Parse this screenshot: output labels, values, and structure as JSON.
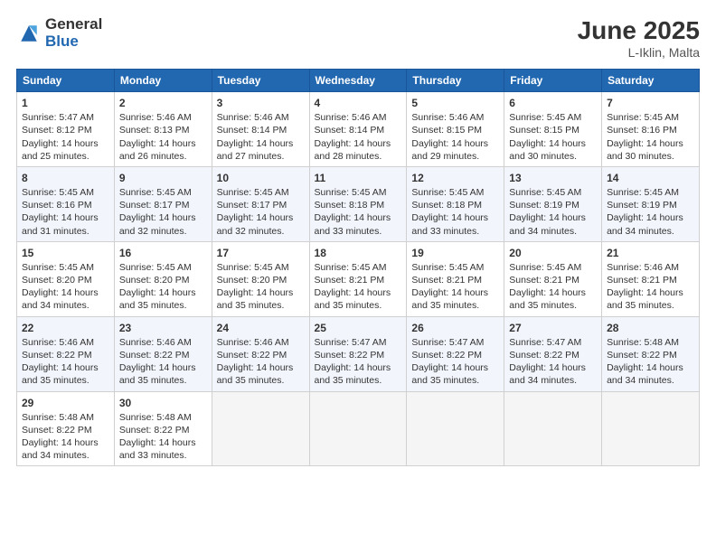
{
  "logo": {
    "general": "General",
    "blue": "Blue"
  },
  "title": "June 2025",
  "subtitle": "L-Iklin, Malta",
  "headers": [
    "Sunday",
    "Monday",
    "Tuesday",
    "Wednesday",
    "Thursday",
    "Friday",
    "Saturday"
  ],
  "weeks": [
    [
      {
        "day": "1",
        "lines": [
          "Sunrise: 5:47 AM",
          "Sunset: 8:12 PM",
          "Daylight: 14 hours",
          "and 25 minutes."
        ]
      },
      {
        "day": "2",
        "lines": [
          "Sunrise: 5:46 AM",
          "Sunset: 8:13 PM",
          "Daylight: 14 hours",
          "and 26 minutes."
        ]
      },
      {
        "day": "3",
        "lines": [
          "Sunrise: 5:46 AM",
          "Sunset: 8:14 PM",
          "Daylight: 14 hours",
          "and 27 minutes."
        ]
      },
      {
        "day": "4",
        "lines": [
          "Sunrise: 5:46 AM",
          "Sunset: 8:14 PM",
          "Daylight: 14 hours",
          "and 28 minutes."
        ]
      },
      {
        "day": "5",
        "lines": [
          "Sunrise: 5:46 AM",
          "Sunset: 8:15 PM",
          "Daylight: 14 hours",
          "and 29 minutes."
        ]
      },
      {
        "day": "6",
        "lines": [
          "Sunrise: 5:45 AM",
          "Sunset: 8:15 PM",
          "Daylight: 14 hours",
          "and 30 minutes."
        ]
      },
      {
        "day": "7",
        "lines": [
          "Sunrise: 5:45 AM",
          "Sunset: 8:16 PM",
          "Daylight: 14 hours",
          "and 30 minutes."
        ]
      }
    ],
    [
      {
        "day": "8",
        "lines": [
          "Sunrise: 5:45 AM",
          "Sunset: 8:16 PM",
          "Daylight: 14 hours",
          "and 31 minutes."
        ]
      },
      {
        "day": "9",
        "lines": [
          "Sunrise: 5:45 AM",
          "Sunset: 8:17 PM",
          "Daylight: 14 hours",
          "and 32 minutes."
        ]
      },
      {
        "day": "10",
        "lines": [
          "Sunrise: 5:45 AM",
          "Sunset: 8:17 PM",
          "Daylight: 14 hours",
          "and 32 minutes."
        ]
      },
      {
        "day": "11",
        "lines": [
          "Sunrise: 5:45 AM",
          "Sunset: 8:18 PM",
          "Daylight: 14 hours",
          "and 33 minutes."
        ]
      },
      {
        "day": "12",
        "lines": [
          "Sunrise: 5:45 AM",
          "Sunset: 8:18 PM",
          "Daylight: 14 hours",
          "and 33 minutes."
        ]
      },
      {
        "day": "13",
        "lines": [
          "Sunrise: 5:45 AM",
          "Sunset: 8:19 PM",
          "Daylight: 14 hours",
          "and 34 minutes."
        ]
      },
      {
        "day": "14",
        "lines": [
          "Sunrise: 5:45 AM",
          "Sunset: 8:19 PM",
          "Daylight: 14 hours",
          "and 34 minutes."
        ]
      }
    ],
    [
      {
        "day": "15",
        "lines": [
          "Sunrise: 5:45 AM",
          "Sunset: 8:20 PM",
          "Daylight: 14 hours",
          "and 34 minutes."
        ]
      },
      {
        "day": "16",
        "lines": [
          "Sunrise: 5:45 AM",
          "Sunset: 8:20 PM",
          "Daylight: 14 hours",
          "and 35 minutes."
        ]
      },
      {
        "day": "17",
        "lines": [
          "Sunrise: 5:45 AM",
          "Sunset: 8:20 PM",
          "Daylight: 14 hours",
          "and 35 minutes."
        ]
      },
      {
        "day": "18",
        "lines": [
          "Sunrise: 5:45 AM",
          "Sunset: 8:21 PM",
          "Daylight: 14 hours",
          "and 35 minutes."
        ]
      },
      {
        "day": "19",
        "lines": [
          "Sunrise: 5:45 AM",
          "Sunset: 8:21 PM",
          "Daylight: 14 hours",
          "and 35 minutes."
        ]
      },
      {
        "day": "20",
        "lines": [
          "Sunrise: 5:45 AM",
          "Sunset: 8:21 PM",
          "Daylight: 14 hours",
          "and 35 minutes."
        ]
      },
      {
        "day": "21",
        "lines": [
          "Sunrise: 5:46 AM",
          "Sunset: 8:21 PM",
          "Daylight: 14 hours",
          "and 35 minutes."
        ]
      }
    ],
    [
      {
        "day": "22",
        "lines": [
          "Sunrise: 5:46 AM",
          "Sunset: 8:22 PM",
          "Daylight: 14 hours",
          "and 35 minutes."
        ]
      },
      {
        "day": "23",
        "lines": [
          "Sunrise: 5:46 AM",
          "Sunset: 8:22 PM",
          "Daylight: 14 hours",
          "and 35 minutes."
        ]
      },
      {
        "day": "24",
        "lines": [
          "Sunrise: 5:46 AM",
          "Sunset: 8:22 PM",
          "Daylight: 14 hours",
          "and 35 minutes."
        ]
      },
      {
        "day": "25",
        "lines": [
          "Sunrise: 5:47 AM",
          "Sunset: 8:22 PM",
          "Daylight: 14 hours",
          "and 35 minutes."
        ]
      },
      {
        "day": "26",
        "lines": [
          "Sunrise: 5:47 AM",
          "Sunset: 8:22 PM",
          "Daylight: 14 hours",
          "and 35 minutes."
        ]
      },
      {
        "day": "27",
        "lines": [
          "Sunrise: 5:47 AM",
          "Sunset: 8:22 PM",
          "Daylight: 14 hours",
          "and 34 minutes."
        ]
      },
      {
        "day": "28",
        "lines": [
          "Sunrise: 5:48 AM",
          "Sunset: 8:22 PM",
          "Daylight: 14 hours",
          "and 34 minutes."
        ]
      }
    ],
    [
      {
        "day": "29",
        "lines": [
          "Sunrise: 5:48 AM",
          "Sunset: 8:22 PM",
          "Daylight: 14 hours",
          "and 34 minutes."
        ]
      },
      {
        "day": "30",
        "lines": [
          "Sunrise: 5:48 AM",
          "Sunset: 8:22 PM",
          "Daylight: 14 hours",
          "and 33 minutes."
        ]
      },
      {
        "day": "",
        "lines": []
      },
      {
        "day": "",
        "lines": []
      },
      {
        "day": "",
        "lines": []
      },
      {
        "day": "",
        "lines": []
      },
      {
        "day": "",
        "lines": []
      }
    ]
  ]
}
